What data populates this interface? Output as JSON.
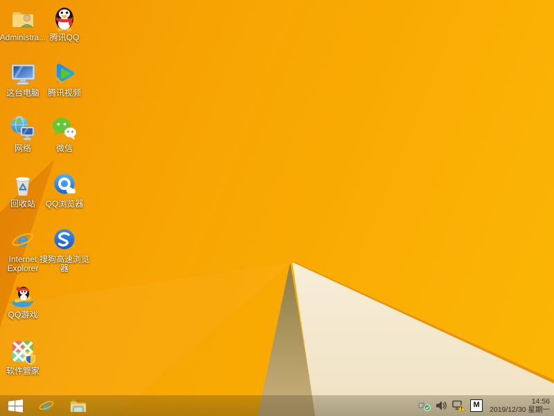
{
  "desktop": {
    "icons": [
      {
        "name": "administrator-folder",
        "label": "Administra..."
      },
      {
        "name": "tencent-qq",
        "label": "腾讯QQ"
      },
      {
        "name": "this-pc",
        "label": "这台电脑"
      },
      {
        "name": "tencent-video",
        "label": "腾讯视频"
      },
      {
        "name": "network",
        "label": "网络"
      },
      {
        "name": "wechat",
        "label": "微信"
      },
      {
        "name": "recycle-bin",
        "label": "回收站"
      },
      {
        "name": "qq-browser",
        "label": "QQ浏览器"
      },
      {
        "name": "internet-explorer",
        "label": "Internet Explorer"
      },
      {
        "name": "sogou-browser",
        "label": "搜狗高速浏览器"
      },
      {
        "name": "qq-games",
        "label": "QQ游戏"
      },
      {
        "name": "software-manager",
        "label": "软件管家"
      }
    ]
  },
  "taskbar": {
    "buttons": [
      {
        "name": "start"
      },
      {
        "name": "internet-explorer"
      },
      {
        "name": "file-explorer"
      }
    ],
    "tray": {
      "icons": [
        {
          "name": "usb-device-safely-remove"
        },
        {
          "name": "volume"
        },
        {
          "name": "network-limited-warning"
        }
      ],
      "ime_badge": "M",
      "time": "14:56",
      "date": "2019/12/30 星期一"
    }
  },
  "colors": {
    "wallpaper_amber": "#F9A702",
    "wallpaper_gold": "#FBB705",
    "wallpaper_dark_wedge": "#E28104",
    "wallpaper_olive": "#B29A5E",
    "wallpaper_cream": "#F5EAD2",
    "edge_strip": "#E6930E",
    "taskbar_tint": "rgba(56,47,20,0.30)"
  }
}
